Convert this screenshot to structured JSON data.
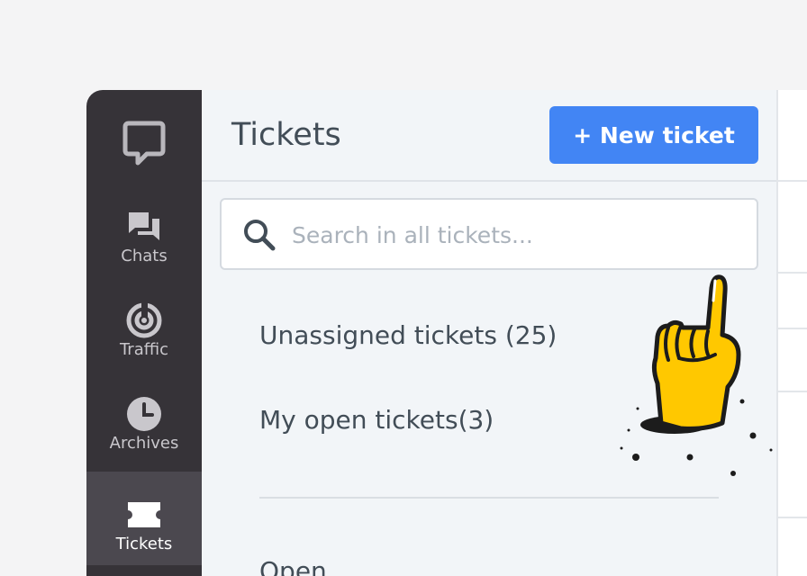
{
  "nav": {
    "items": [
      {
        "label": "Chats",
        "icon": "chats-icon",
        "active": false
      },
      {
        "label": "Traffic",
        "icon": "traffic-icon",
        "active": false
      },
      {
        "label": "Archives",
        "icon": "clock-icon",
        "active": false
      },
      {
        "label": "Tickets",
        "icon": "ticket-icon",
        "active": true
      }
    ]
  },
  "header": {
    "title": "Tickets",
    "new_button_label": "+ New ticket"
  },
  "search": {
    "placeholder": "Search in all tickets..."
  },
  "lists": {
    "unassigned": "Unassigned tickets (25)",
    "my_open": "My open tickets(3)",
    "open_partial": "Open"
  },
  "colors": {
    "sidebar": "#363338",
    "sidebar_active": "#4b484f",
    "accent": "#4285f4",
    "hand": "#ffc800"
  }
}
